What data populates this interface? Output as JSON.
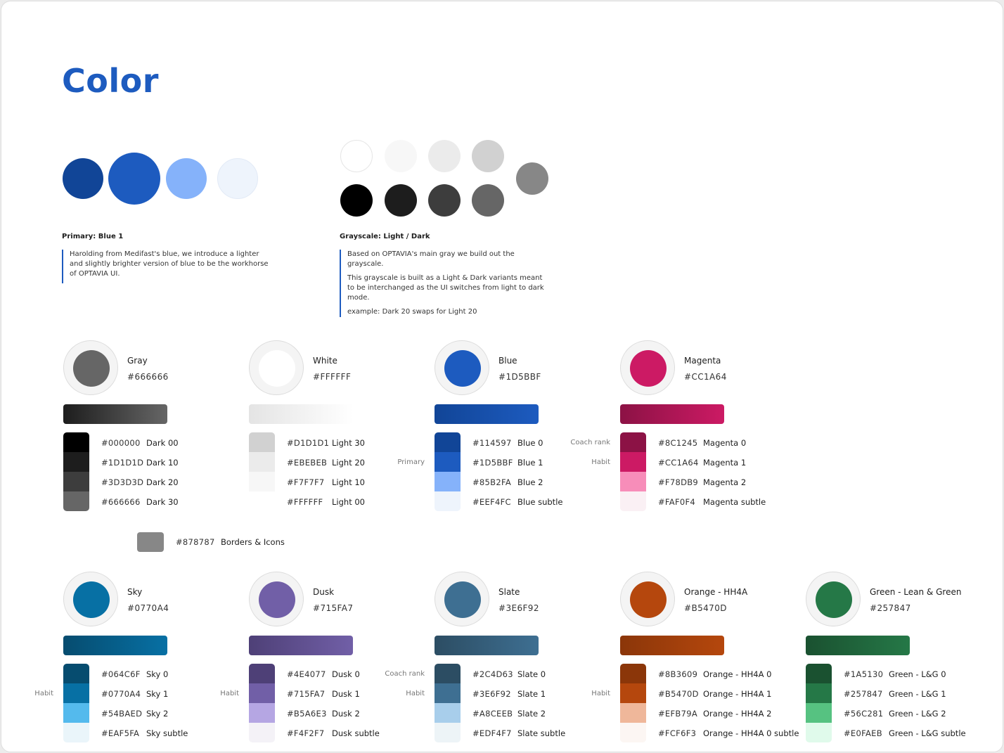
{
  "page": {
    "title": "Color"
  },
  "primary": {
    "heading": "Primary: Blue 1",
    "paragraph": "Harolding from Medifast's blue, we introduce a lighter and slightly brighter version of blue to be the workhorse of OPTAVIA UI.",
    "circles": [
      "#114597",
      "#1D5BBF",
      "#85B2FA",
      "#EEF4FC"
    ]
  },
  "grayscale": {
    "heading": "Grayscale: Light / Dark",
    "p1": "Based on OPTAVIA's main gray we build out the grayscale.",
    "p2": "This grayscale is built as a Light & Dark variants meant to be interchanged as the UI switches from light to dark mode.",
    "p3": "example: Dark 20 swaps for Light 20",
    "light_row": [
      "#FFFFFF",
      "#F7F7F7",
      "#EBEBEB",
      "#D1D1D1"
    ],
    "dark_row": [
      "#000000",
      "#1D1D1D",
      "#3D3D3D",
      "#666666"
    ],
    "mid": "#878787"
  },
  "swatches": [
    {
      "name": "Gray",
      "hex": "#666666",
      "core": "#666666",
      "grad": [
        "#1d1d1d",
        "#666666"
      ],
      "rows": [
        {
          "hex": "#000000",
          "name": "Dark 00",
          "color": "#000000"
        },
        {
          "hex": "#1D1D1D",
          "name": "Dark 10",
          "color": "#1D1D1D"
        },
        {
          "hex": "#3D3D3D",
          "name": "Dark 20",
          "color": "#3D3D3D"
        },
        {
          "hex": "#666666",
          "name": "Dark 30",
          "color": "#666666"
        }
      ],
      "notes": []
    },
    {
      "name": "White",
      "hex": "#FFFFFF",
      "core": "#FFFFFF",
      "grad": [
        "#e4e4e4",
        "#ffffff"
      ],
      "rows": [
        {
          "hex": "#D1D1D1",
          "name": "Light 30",
          "color": "#D1D1D1"
        },
        {
          "hex": "#EBEBEB",
          "name": "Light 20",
          "color": "#EBEBEB"
        },
        {
          "hex": "#F7F7F7",
          "name": "Light 10",
          "color": "#F7F7F7"
        },
        {
          "hex": "#FFFFFF",
          "name": "Light 00",
          "color": "#FFFFFF"
        }
      ],
      "notes": []
    },
    {
      "name": "Blue",
      "hex": "#1D5BBF",
      "core": "#1D5BBF",
      "grad": [
        "#114597",
        "#1D5BBF"
      ],
      "rows": [
        {
          "hex": "#114597",
          "name": "Blue 0",
          "color": "#114597"
        },
        {
          "hex": "#1D5BBF",
          "name": "Blue 1",
          "color": "#1D5BBF"
        },
        {
          "hex": "#85B2FA",
          "name": "Blue 2",
          "color": "#85B2FA"
        },
        {
          "hex": "#EEF4FC",
          "name": "Blue subtle",
          "color": "#EEF4FC"
        }
      ],
      "notes": [
        "",
        "Primary",
        "",
        ""
      ]
    },
    {
      "name": "Magenta",
      "hex": "#CC1A64",
      "core": "#CC1A64",
      "grad": [
        "#8C1245",
        "#CC1A64"
      ],
      "rows": [
        {
          "hex": "#8C1245",
          "name": "Magenta 0",
          "color": "#8C1245"
        },
        {
          "hex": "#CC1A64",
          "name": "Magenta 1",
          "color": "#CC1A64"
        },
        {
          "hex": "#F78DB9",
          "name": "Magenta 2",
          "color": "#F78DB9"
        },
        {
          "hex": "#FAF0F4",
          "name": "Magenta subtle",
          "color": "#FAF0F4"
        }
      ],
      "notes": [
        "Coach rank",
        "Habit",
        "",
        ""
      ]
    },
    {
      "name": "Sky",
      "hex": "#0770A4",
      "core": "#0770A4",
      "grad": [
        "#064C6F",
        "#0770A4"
      ],
      "rows": [
        {
          "hex": "#064C6F",
          "name": "Sky 0",
          "color": "#064C6F"
        },
        {
          "hex": "#0770A4",
          "name": "Sky 1",
          "color": "#0770A4"
        },
        {
          "hex": "#54BAED",
          "name": "Sky 2",
          "color": "#54BAED"
        },
        {
          "hex": "#EAF5FA",
          "name": "Sky subtle",
          "color": "#EAF5FA"
        }
      ],
      "notes": [
        "",
        "Habit",
        "",
        ""
      ]
    },
    {
      "name": "Dusk",
      "hex": "#715FA7",
      "core": "#715FA7",
      "grad": [
        "#4E4077",
        "#715FA7"
      ],
      "rows": [
        {
          "hex": "#4E4077",
          "name": "Dusk 0",
          "color": "#4E4077"
        },
        {
          "hex": "#715FA7",
          "name": "Dusk 1",
          "color": "#715FA7"
        },
        {
          "hex": "#B5A6E3",
          "name": "Dusk 2",
          "color": "#B5A6E3"
        },
        {
          "hex": "#F4F2F7",
          "name": "Dusk subtle",
          "color": "#F4F2F7"
        }
      ],
      "notes": [
        "",
        "Habit",
        "",
        ""
      ]
    },
    {
      "name": "Slate",
      "hex": "#3E6F92",
      "core": "#3E6F92",
      "grad": [
        "#2C4D63",
        "#3E6F92"
      ],
      "rows": [
        {
          "hex": "#2C4D63",
          "name": "Slate 0",
          "color": "#2C4D63"
        },
        {
          "hex": "#3E6F92",
          "name": "Slate 1",
          "color": "#3E6F92"
        },
        {
          "hex": "#A8CEEB",
          "name": "Slate 2",
          "color": "#A8CEEB"
        },
        {
          "hex": "#EDF4F7",
          "name": "Slate subtle",
          "color": "#EDF4F7"
        }
      ],
      "notes": [
        "Coach rank",
        "Habit",
        "",
        ""
      ]
    },
    {
      "name": "Orange - HH4A",
      "hex": "#B5470D",
      "core": "#B5470D",
      "grad": [
        "#8B3609",
        "#B5470D"
      ],
      "rows": [
        {
          "hex": "#8B3609",
          "name": "Orange - HH4A 0",
          "color": "#8B3609"
        },
        {
          "hex": "#B5470D",
          "name": "Orange - HH4A 1",
          "color": "#B5470D"
        },
        {
          "hex": "#EFB79A",
          "name": "Orange - HH4A 2",
          "color": "#EFB79A"
        },
        {
          "hex": "#FCF6F3",
          "name": "Orange - HH4A 0 subtle",
          "color": "#FCF6F3"
        }
      ],
      "notes": [
        "",
        "Habit",
        "",
        ""
      ]
    },
    {
      "name": "Green - Lean & Green",
      "hex": "#257847",
      "core": "#257847",
      "grad": [
        "#1A5130",
        "#257847"
      ],
      "rows": [
        {
          "hex": "#1A5130",
          "name": "Green - L&G 0",
          "color": "#1A5130"
        },
        {
          "hex": "#257847",
          "name": "Green - L&G 1",
          "color": "#257847"
        },
        {
          "hex": "#56C281",
          "name": "Green - L&G 2",
          "color": "#56C281"
        },
        {
          "hex": "#E0FAEB",
          "name": "Green - L&G subtle",
          "color": "#E0FAEB"
        }
      ],
      "notes": []
    }
  ],
  "borders": {
    "hex": "#878787",
    "name": "Borders & Icons"
  }
}
